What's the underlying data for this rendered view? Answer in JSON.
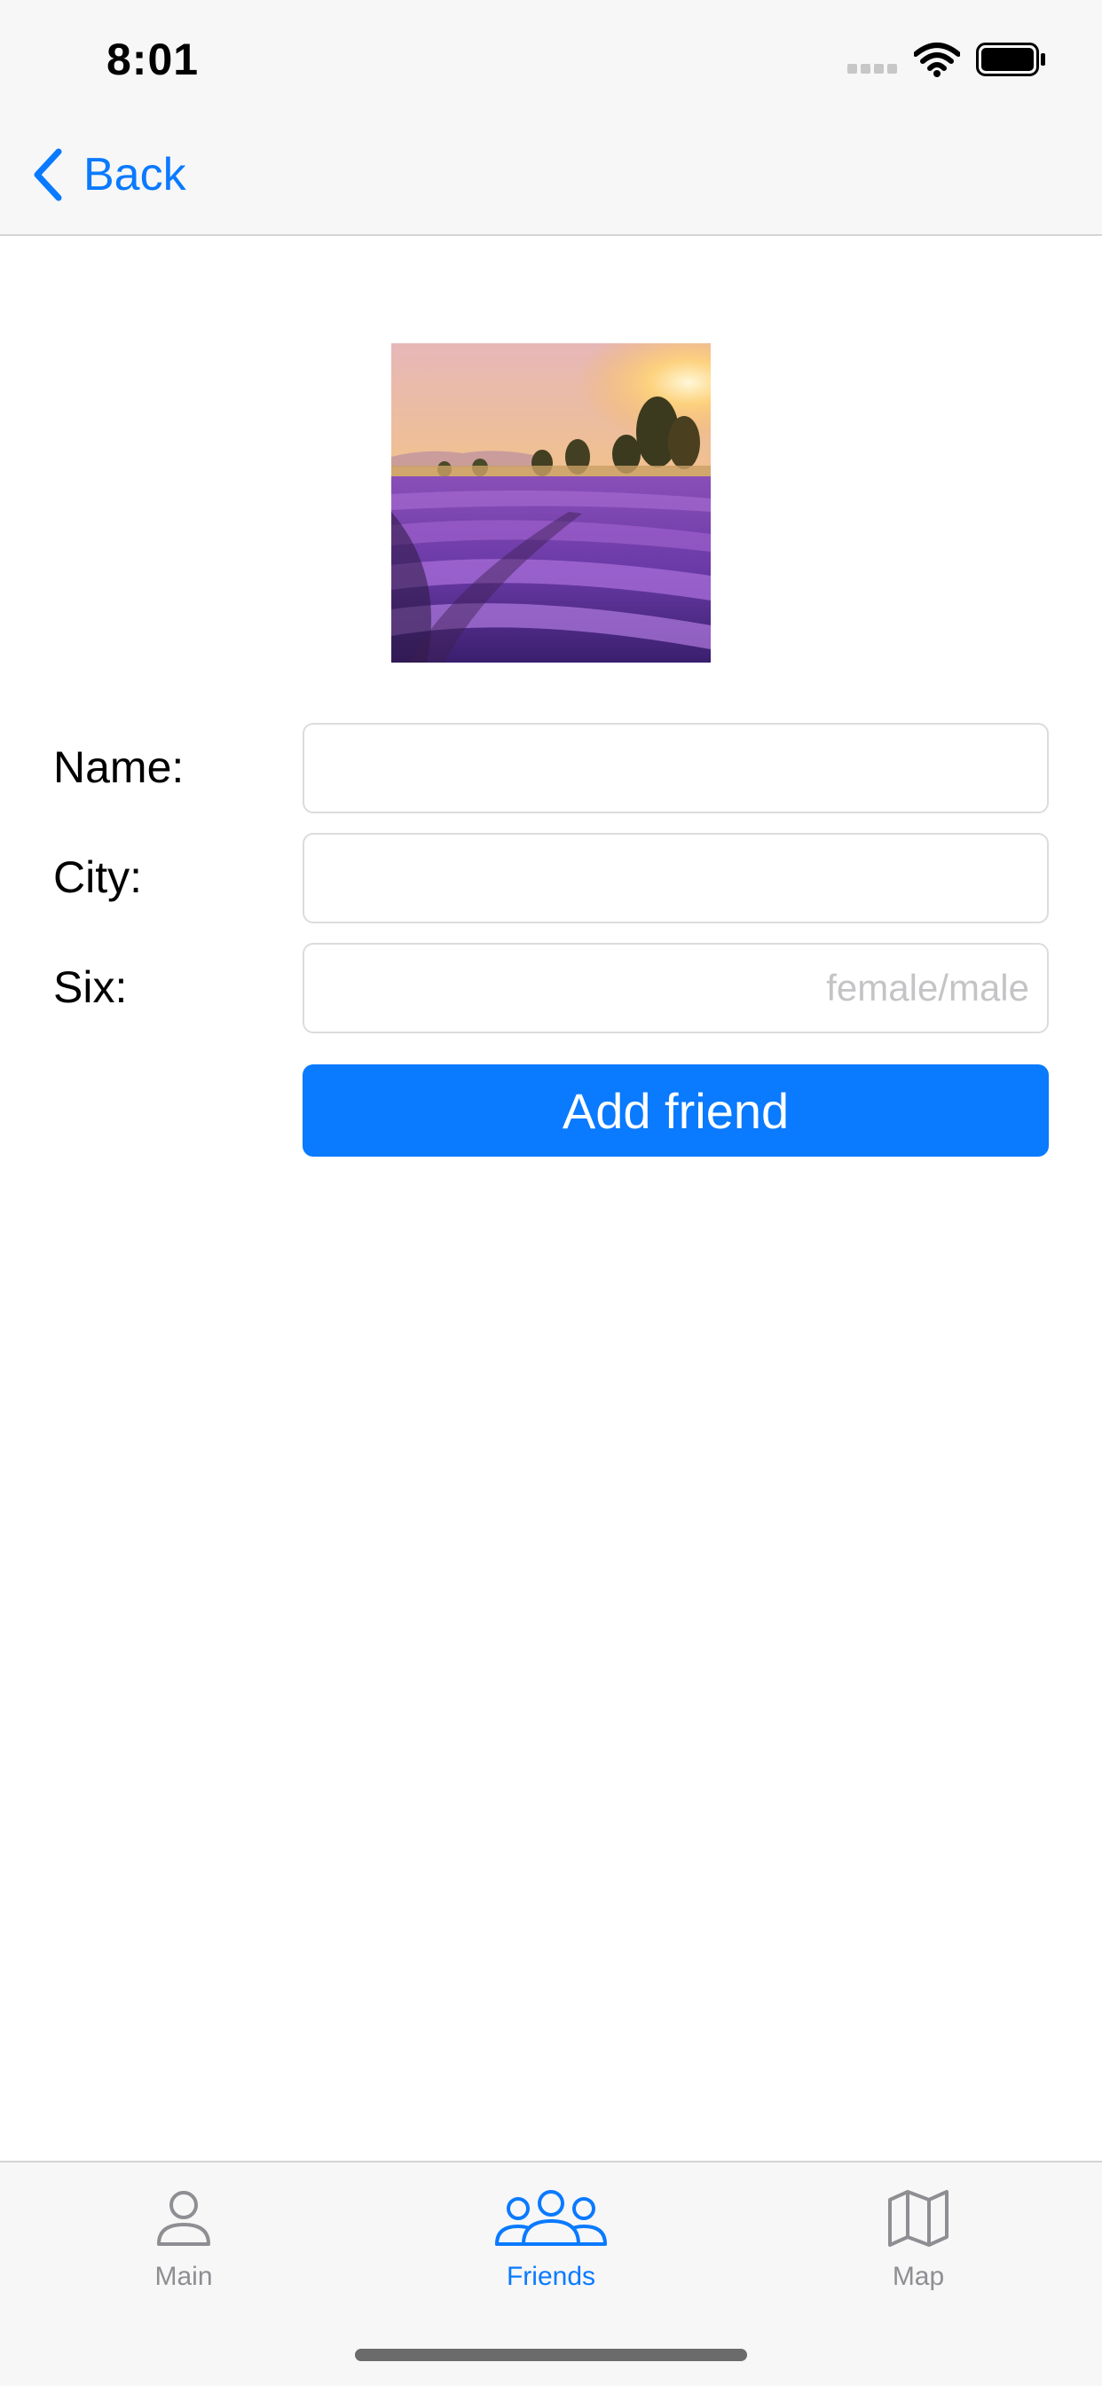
{
  "status_bar": {
    "time": "8:01",
    "icons": [
      "signal-dots-icon",
      "wifi-icon",
      "battery-icon"
    ]
  },
  "nav": {
    "back_label": "Back",
    "back_icon": "chevron-left-icon"
  },
  "photo": {
    "subject": "lavender-field-at-sunset"
  },
  "form": {
    "name": {
      "label": "Name:",
      "value": "",
      "placeholder": ""
    },
    "city": {
      "label": "City:",
      "value": "",
      "placeholder": ""
    },
    "six": {
      "label": "Six:",
      "value": "",
      "placeholder": "female/male"
    },
    "submit_label": "Add friend"
  },
  "tabs": [
    {
      "label": "Main",
      "icon": "person-icon",
      "active": false
    },
    {
      "label": "Friends",
      "icon": "people-group-icon",
      "active": true
    },
    {
      "label": "Map",
      "icon": "map-icon",
      "active": false
    }
  ],
  "colors": {
    "accent": "#0a7aff",
    "bar_background": "#f7f7f7",
    "inactive_tab": "#8e8e93",
    "placeholder": "#c4c4c6"
  }
}
